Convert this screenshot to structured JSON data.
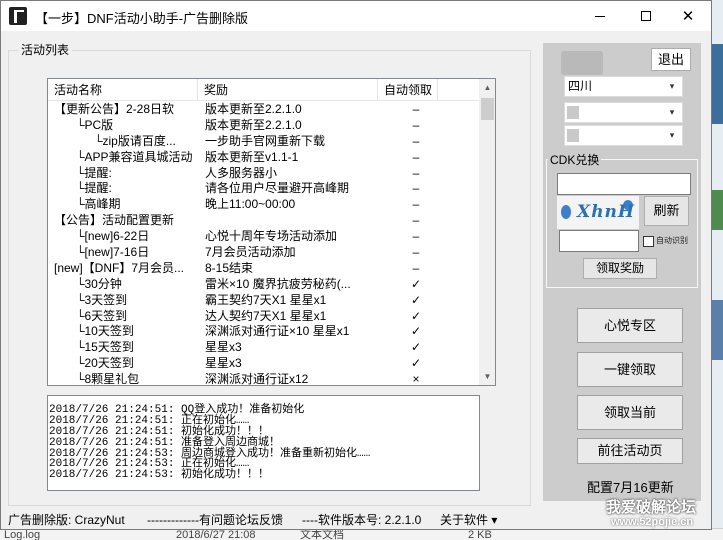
{
  "window": {
    "title": "【一步】DNF活动小助手-广告删除版",
    "controls": {
      "minimize": "minimize-icon",
      "maximize": "maximize-icon",
      "close": "close-icon"
    }
  },
  "activity_list": {
    "group_title": "活动列表",
    "columns": [
      "活动名称",
      "奖励",
      "自动领取"
    ],
    "rows": [
      {
        "indent": 1,
        "name": "【更新公告】2-28日软",
        "reward": "版本更新至2.2.1.0",
        "auto": "–"
      },
      {
        "indent": 2,
        "name": "└PC版",
        "reward": "版本更新至2.2.1.0",
        "auto": "–"
      },
      {
        "indent": 3,
        "name": "└zip版请百度...",
        "reward": "一步助手官网重新下载",
        "auto": "–"
      },
      {
        "indent": 2,
        "name": "└APP兼容道具城活动",
        "reward": "版本更新至v1.1-1",
        "auto": "–"
      },
      {
        "indent": 2,
        "name": "└提醒:",
        "reward": "人多服务器小",
        "auto": "–"
      },
      {
        "indent": 2,
        "name": "└提醒:",
        "reward": "请各位用户尽量避开高峰期",
        "auto": "–"
      },
      {
        "indent": 2,
        "name": "└高峰期",
        "reward": "晚上11:00~00:00",
        "auto": "–"
      },
      {
        "indent": 1,
        "name": "【公告】活动配置更新",
        "reward": "",
        "auto": "–"
      },
      {
        "indent": 2,
        "name": "└[new]6-22日",
        "reward": "心悦十周年专场活动添加",
        "auto": "–"
      },
      {
        "indent": 2,
        "name": "└[new]7-16日",
        "reward": "7月会员活动添加",
        "auto": "–"
      },
      {
        "indent": 1,
        "name": "[new]【DNF】7月会员...",
        "reward": "8-15结束",
        "auto": "–"
      },
      {
        "indent": 2,
        "name": "└30分钟",
        "reward": "雷米×10 魔界抗疲劳秘药(...",
        "auto": "✓"
      },
      {
        "indent": 2,
        "name": "└3天签到",
        "reward": "霸王契约7天X1 星星x1",
        "auto": "✓"
      },
      {
        "indent": 2,
        "name": "└6天签到",
        "reward": "达人契约7天X1 星星x1",
        "auto": "✓"
      },
      {
        "indent": 2,
        "name": "└10天签到",
        "reward": "深渊派对通行证×10 星星x1",
        "auto": "✓"
      },
      {
        "indent": 2,
        "name": "└15天签到",
        "reward": "星星x3",
        "auto": "✓"
      },
      {
        "indent": 2,
        "name": "└20天签到",
        "reward": "星星x3",
        "auto": "✓"
      },
      {
        "indent": 2,
        "name": "└8颗星礼包",
        "reward": "深渊派对通行证x12",
        "auto": "×"
      }
    ]
  },
  "log": {
    "lines": [
      "2018/7/26 21:24:51: QQ登入成功！准备初始化",
      "2018/7/26 21:24:51: 正在初始化……",
      "2018/7/26 21:24:51: 初始化成功！！！",
      "2018/7/26 21:24:51: 准备登入周边商城！",
      "2018/7/26 21:24:53: 周边商城登入成功！准备重新初始化……",
      "2018/7/26 21:24:53: 正在初始化……",
      "2018/7/26 21:24:53: 初始化成功！！！"
    ]
  },
  "right_panel": {
    "logout_label": "退出",
    "province_value": "四川",
    "select2_value": "",
    "select3_value": "",
    "cdk_title": "CDK兑换",
    "cdk_input_value": "",
    "captcha_text": "XhnH",
    "refresh_label": "刷新",
    "code_input_value": "",
    "auto_check_label": "自动识别",
    "claim_label": "领取奖励",
    "buttons": [
      "心悦专区",
      "一键领取",
      "领取当前",
      "前往活动页"
    ],
    "config_text": "配置7月16更新"
  },
  "statusbar": {
    "ad_removed": "广告删除版: CrazyNut",
    "feedback": "-------------有问题论坛反馈",
    "version": "----软件版本号: 2.2.1.0",
    "about": "关于软件 ▾"
  },
  "watermark": {
    "line1": "我爱破解论坛",
    "line2": "www.52pojie.cn"
  },
  "background": {
    "bottom_items": [
      "Log.log",
      "2018/6/27 21:08",
      "文本文档",
      "2 KB"
    ]
  },
  "colors": {
    "panel": "#cccccc",
    "window_bg": "#f0f0f0",
    "captcha_blue": "#2e6fb3"
  }
}
